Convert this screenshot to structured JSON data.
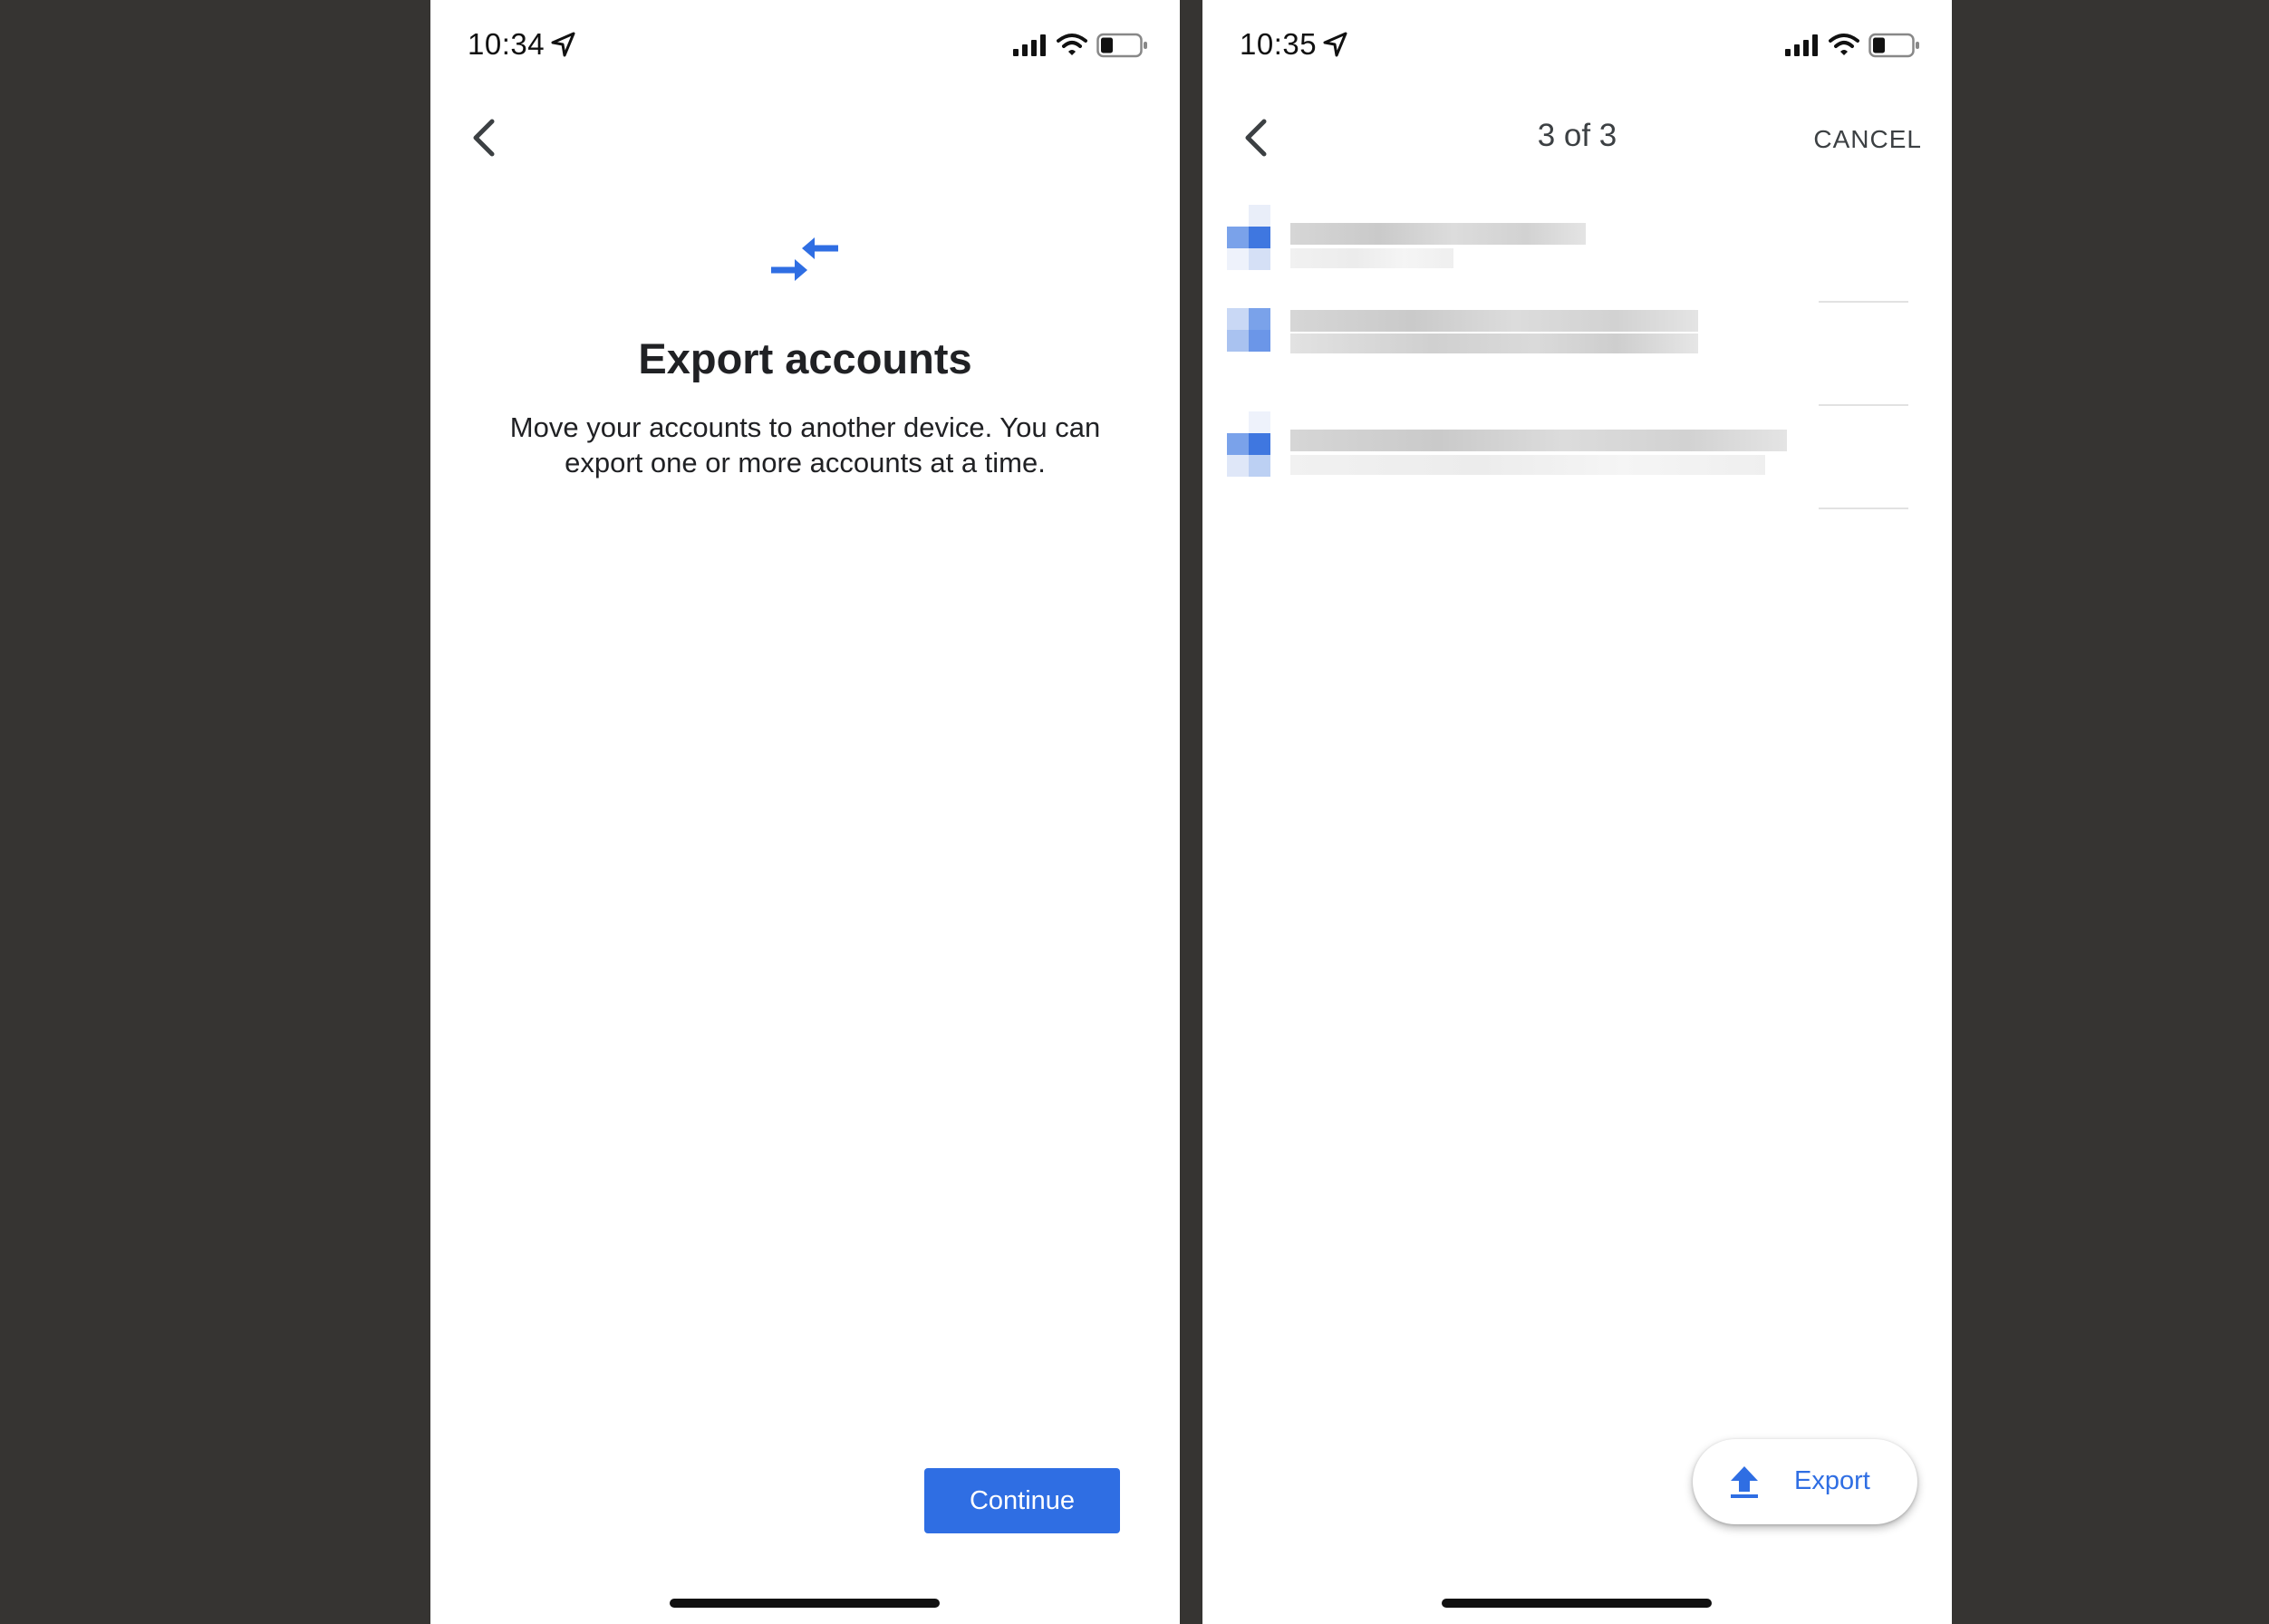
{
  "left_screen": {
    "status": {
      "time": "10:34"
    },
    "title": "Export accounts",
    "description": "Move your accounts to another device. You can export one or more accounts at a time.",
    "continue_label": "Continue"
  },
  "right_screen": {
    "status": {
      "time": "10:35"
    },
    "header": {
      "count": "3 of 3",
      "cancel_label": "CANCEL"
    },
    "accounts_redacted": 3,
    "export_label": "Export"
  },
  "colors": {
    "accent_blue": "#2f6ee3",
    "background": "#363432",
    "text": "#202124"
  },
  "icons": [
    "back-chevron-icon",
    "export-arrows-icon",
    "upload-icon",
    "location-arrow-icon",
    "signal-icon",
    "wifi-icon",
    "battery-icon"
  ]
}
